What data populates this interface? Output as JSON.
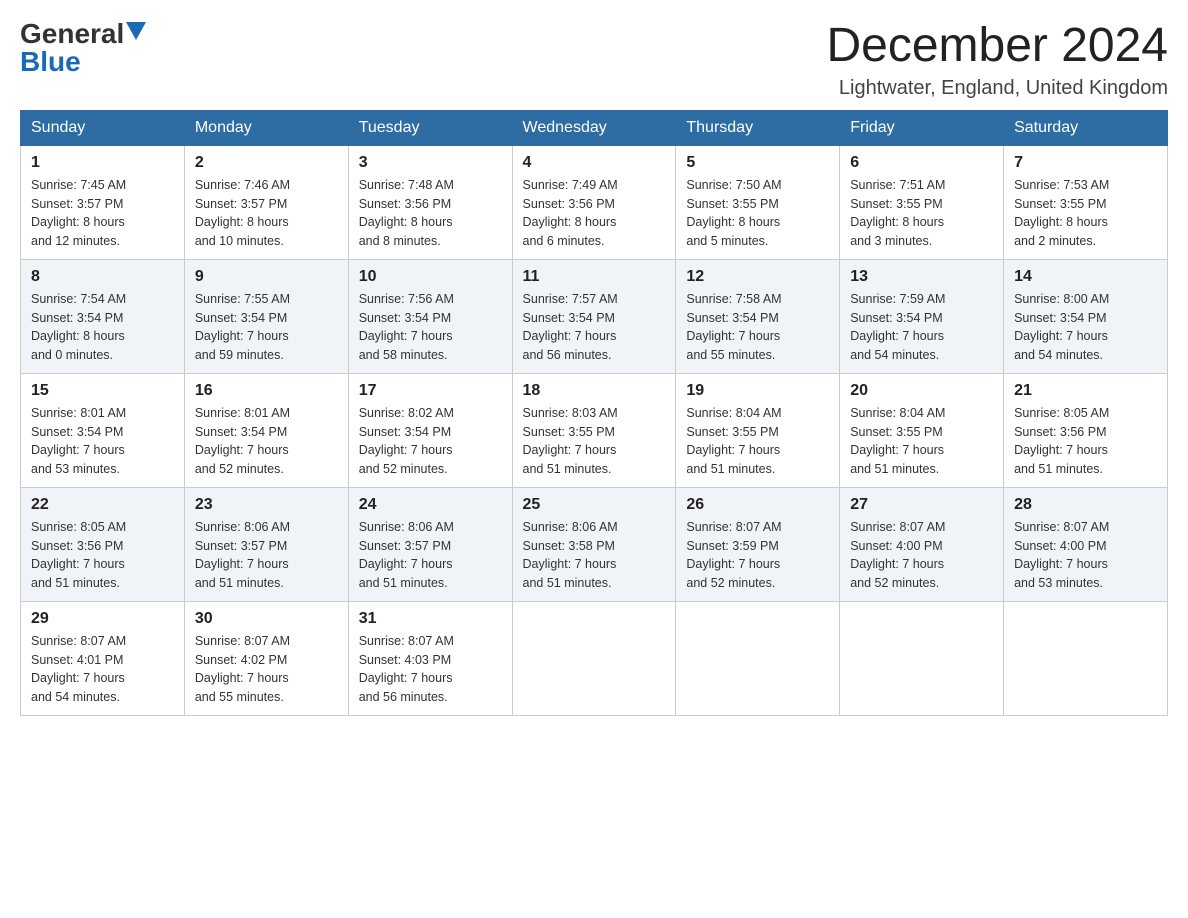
{
  "logo": {
    "general": "General",
    "blue": "Blue"
  },
  "title": "December 2024",
  "location": "Lightwater, England, United Kingdom",
  "weekdays": [
    "Sunday",
    "Monday",
    "Tuesday",
    "Wednesday",
    "Thursday",
    "Friday",
    "Saturday"
  ],
  "weeks": [
    [
      {
        "day": "1",
        "info": "Sunrise: 7:45 AM\nSunset: 3:57 PM\nDaylight: 8 hours\nand 12 minutes."
      },
      {
        "day": "2",
        "info": "Sunrise: 7:46 AM\nSunset: 3:57 PM\nDaylight: 8 hours\nand 10 minutes."
      },
      {
        "day": "3",
        "info": "Sunrise: 7:48 AM\nSunset: 3:56 PM\nDaylight: 8 hours\nand 8 minutes."
      },
      {
        "day": "4",
        "info": "Sunrise: 7:49 AM\nSunset: 3:56 PM\nDaylight: 8 hours\nand 6 minutes."
      },
      {
        "day": "5",
        "info": "Sunrise: 7:50 AM\nSunset: 3:55 PM\nDaylight: 8 hours\nand 5 minutes."
      },
      {
        "day": "6",
        "info": "Sunrise: 7:51 AM\nSunset: 3:55 PM\nDaylight: 8 hours\nand 3 minutes."
      },
      {
        "day": "7",
        "info": "Sunrise: 7:53 AM\nSunset: 3:55 PM\nDaylight: 8 hours\nand 2 minutes."
      }
    ],
    [
      {
        "day": "8",
        "info": "Sunrise: 7:54 AM\nSunset: 3:54 PM\nDaylight: 8 hours\nand 0 minutes."
      },
      {
        "day": "9",
        "info": "Sunrise: 7:55 AM\nSunset: 3:54 PM\nDaylight: 7 hours\nand 59 minutes."
      },
      {
        "day": "10",
        "info": "Sunrise: 7:56 AM\nSunset: 3:54 PM\nDaylight: 7 hours\nand 58 minutes."
      },
      {
        "day": "11",
        "info": "Sunrise: 7:57 AM\nSunset: 3:54 PM\nDaylight: 7 hours\nand 56 minutes."
      },
      {
        "day": "12",
        "info": "Sunrise: 7:58 AM\nSunset: 3:54 PM\nDaylight: 7 hours\nand 55 minutes."
      },
      {
        "day": "13",
        "info": "Sunrise: 7:59 AM\nSunset: 3:54 PM\nDaylight: 7 hours\nand 54 minutes."
      },
      {
        "day": "14",
        "info": "Sunrise: 8:00 AM\nSunset: 3:54 PM\nDaylight: 7 hours\nand 54 minutes."
      }
    ],
    [
      {
        "day": "15",
        "info": "Sunrise: 8:01 AM\nSunset: 3:54 PM\nDaylight: 7 hours\nand 53 minutes."
      },
      {
        "day": "16",
        "info": "Sunrise: 8:01 AM\nSunset: 3:54 PM\nDaylight: 7 hours\nand 52 minutes."
      },
      {
        "day": "17",
        "info": "Sunrise: 8:02 AM\nSunset: 3:54 PM\nDaylight: 7 hours\nand 52 minutes."
      },
      {
        "day": "18",
        "info": "Sunrise: 8:03 AM\nSunset: 3:55 PM\nDaylight: 7 hours\nand 51 minutes."
      },
      {
        "day": "19",
        "info": "Sunrise: 8:04 AM\nSunset: 3:55 PM\nDaylight: 7 hours\nand 51 minutes."
      },
      {
        "day": "20",
        "info": "Sunrise: 8:04 AM\nSunset: 3:55 PM\nDaylight: 7 hours\nand 51 minutes."
      },
      {
        "day": "21",
        "info": "Sunrise: 8:05 AM\nSunset: 3:56 PM\nDaylight: 7 hours\nand 51 minutes."
      }
    ],
    [
      {
        "day": "22",
        "info": "Sunrise: 8:05 AM\nSunset: 3:56 PM\nDaylight: 7 hours\nand 51 minutes."
      },
      {
        "day": "23",
        "info": "Sunrise: 8:06 AM\nSunset: 3:57 PM\nDaylight: 7 hours\nand 51 minutes."
      },
      {
        "day": "24",
        "info": "Sunrise: 8:06 AM\nSunset: 3:57 PM\nDaylight: 7 hours\nand 51 minutes."
      },
      {
        "day": "25",
        "info": "Sunrise: 8:06 AM\nSunset: 3:58 PM\nDaylight: 7 hours\nand 51 minutes."
      },
      {
        "day": "26",
        "info": "Sunrise: 8:07 AM\nSunset: 3:59 PM\nDaylight: 7 hours\nand 52 minutes."
      },
      {
        "day": "27",
        "info": "Sunrise: 8:07 AM\nSunset: 4:00 PM\nDaylight: 7 hours\nand 52 minutes."
      },
      {
        "day": "28",
        "info": "Sunrise: 8:07 AM\nSunset: 4:00 PM\nDaylight: 7 hours\nand 53 minutes."
      }
    ],
    [
      {
        "day": "29",
        "info": "Sunrise: 8:07 AM\nSunset: 4:01 PM\nDaylight: 7 hours\nand 54 minutes."
      },
      {
        "day": "30",
        "info": "Sunrise: 8:07 AM\nSunset: 4:02 PM\nDaylight: 7 hours\nand 55 minutes."
      },
      {
        "day": "31",
        "info": "Sunrise: 8:07 AM\nSunset: 4:03 PM\nDaylight: 7 hours\nand 56 minutes."
      },
      {
        "day": "",
        "info": ""
      },
      {
        "day": "",
        "info": ""
      },
      {
        "day": "",
        "info": ""
      },
      {
        "day": "",
        "info": ""
      }
    ]
  ]
}
